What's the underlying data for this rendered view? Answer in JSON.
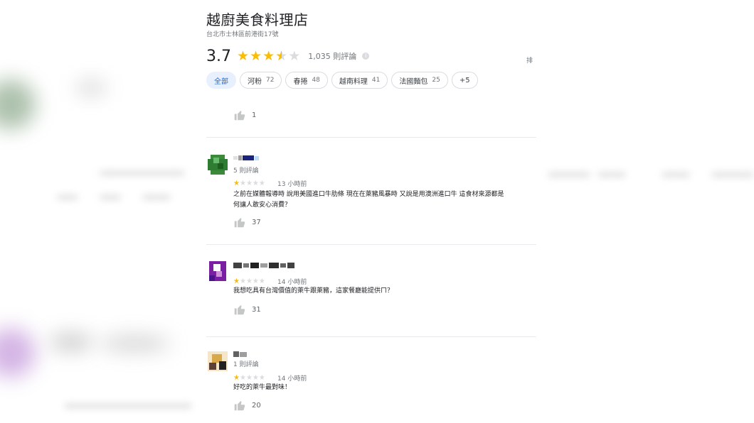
{
  "place": {
    "name": "越廚美食料理店",
    "address": "台北市士林區前港街17號",
    "rating": "3.7",
    "rating_value": 3.7,
    "review_count": "1,035 則評論",
    "sort_label": "排"
  },
  "chips": [
    {
      "label": "全部",
      "count": "",
      "active": true
    },
    {
      "label": "河粉",
      "count": "72",
      "active": false
    },
    {
      "label": "春捲",
      "count": "48",
      "active": false
    },
    {
      "label": "越南料理",
      "count": "41",
      "active": false
    },
    {
      "label": "法國麵包",
      "count": "25",
      "active": false
    },
    {
      "label": "+5",
      "count": "",
      "active": false
    }
  ],
  "top_like": {
    "count": "1"
  },
  "reviews": [
    {
      "reviewer_meta": "5 則評論",
      "stars": 1,
      "time": "13 小時前",
      "text_lines": [
        "之前在媒體報導時 說用美國進口牛肋條 現在在萊豬風暴時 又說是用澳洲進口牛 這食材來源都是",
        "何讓人敢安心消費？"
      ],
      "likes": "37",
      "avatar_color": "#2e7d32"
    },
    {
      "reviewer_meta": "",
      "stars": 1,
      "time": "14 小時前",
      "text_lines": [
        "我想吃具有台灣價值的萊牛跟萊豬，這家餐廳能提供ㄇ？"
      ],
      "likes": "31",
      "avatar_color": "#6a1b9a"
    },
    {
      "reviewer_meta": "1 則評論",
      "stars": 1,
      "time": "14 小時前",
      "text_lines": [
        "好吃的萊牛最對味！"
      ],
      "likes": "20",
      "avatar_color": "#8d6e3f"
    }
  ],
  "icons": {
    "star": "star-icon",
    "thumb": "thumb-up-icon",
    "info": "info-icon"
  }
}
